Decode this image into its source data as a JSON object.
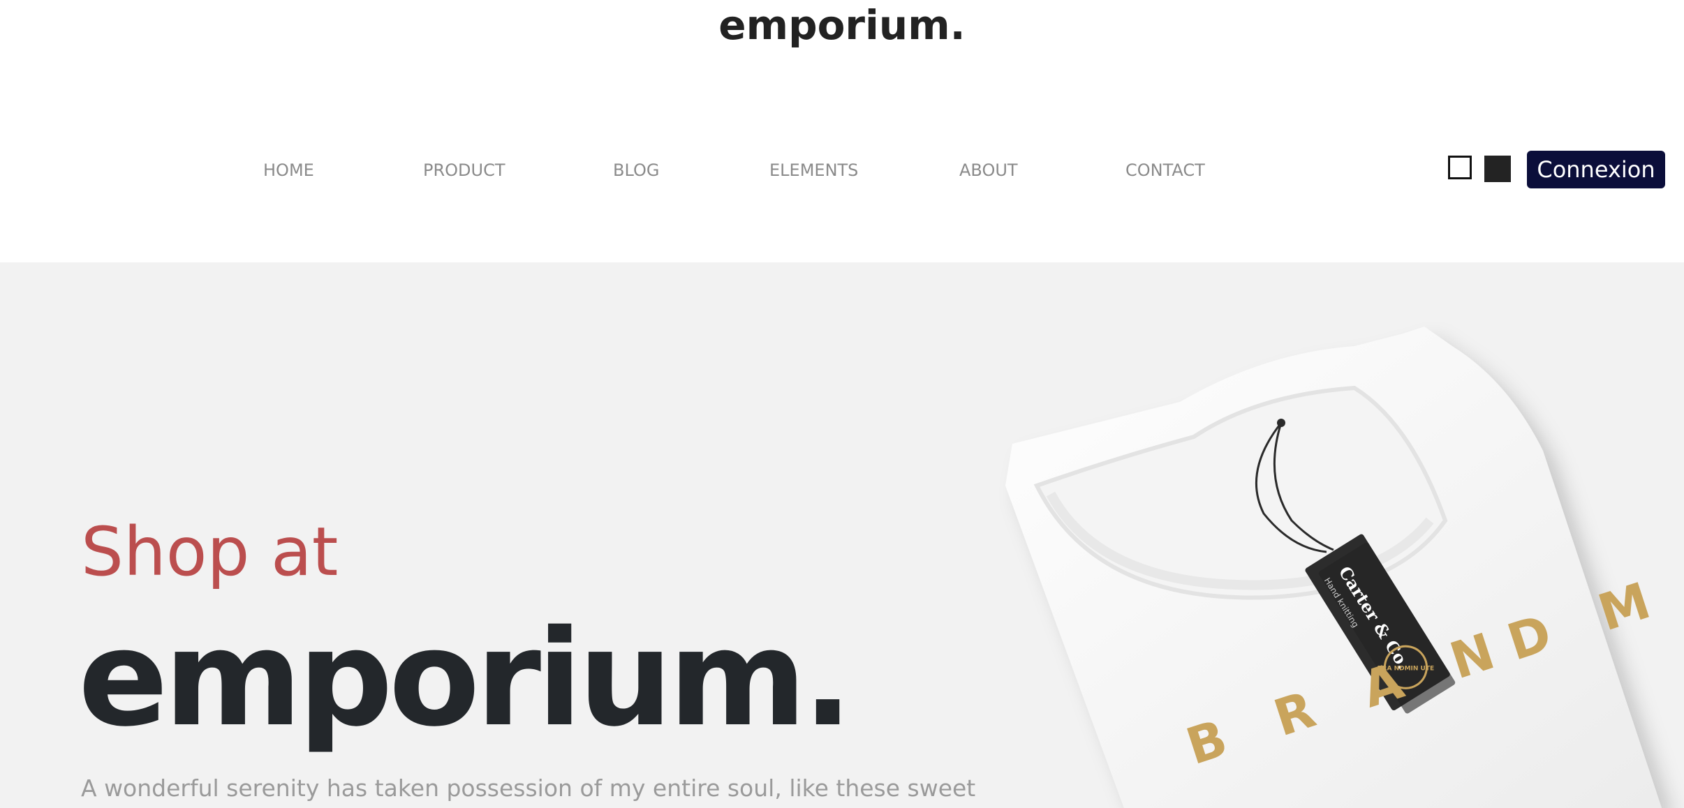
{
  "header": {
    "logo": "emporium."
  },
  "nav": {
    "items": [
      {
        "label": "HOME"
      },
      {
        "label": "PRODUCT"
      },
      {
        "label": "BLOG"
      },
      {
        "label": "ELEMENTS"
      },
      {
        "label": "ABOUT"
      },
      {
        "label": "CONTACT"
      }
    ]
  },
  "actions": {
    "connexion_label": "Connexion",
    "toggle_light_icon": "square-outline-icon",
    "toggle_dark_icon": "square-filled-icon"
  },
  "hero": {
    "pre_title": "Shop at",
    "title": "emporium.",
    "description": "A wonderful serenity has taken possession of my entire soul, like these sweet"
  },
  "product_image": {
    "tag_brand": "Carter & Co.",
    "tag_sub": "Hand knitting",
    "seal_text": "BRA NDMIN UTE",
    "shirt_print": "B R A ND M"
  },
  "colors": {
    "accent_red": "#bb4e4e",
    "dark_text": "#23272b",
    "button_navy": "#0b0e3a",
    "hero_bg": "#f2f2f2",
    "nav_gray": "#8a8a8a",
    "gold": "#c9a45c"
  }
}
